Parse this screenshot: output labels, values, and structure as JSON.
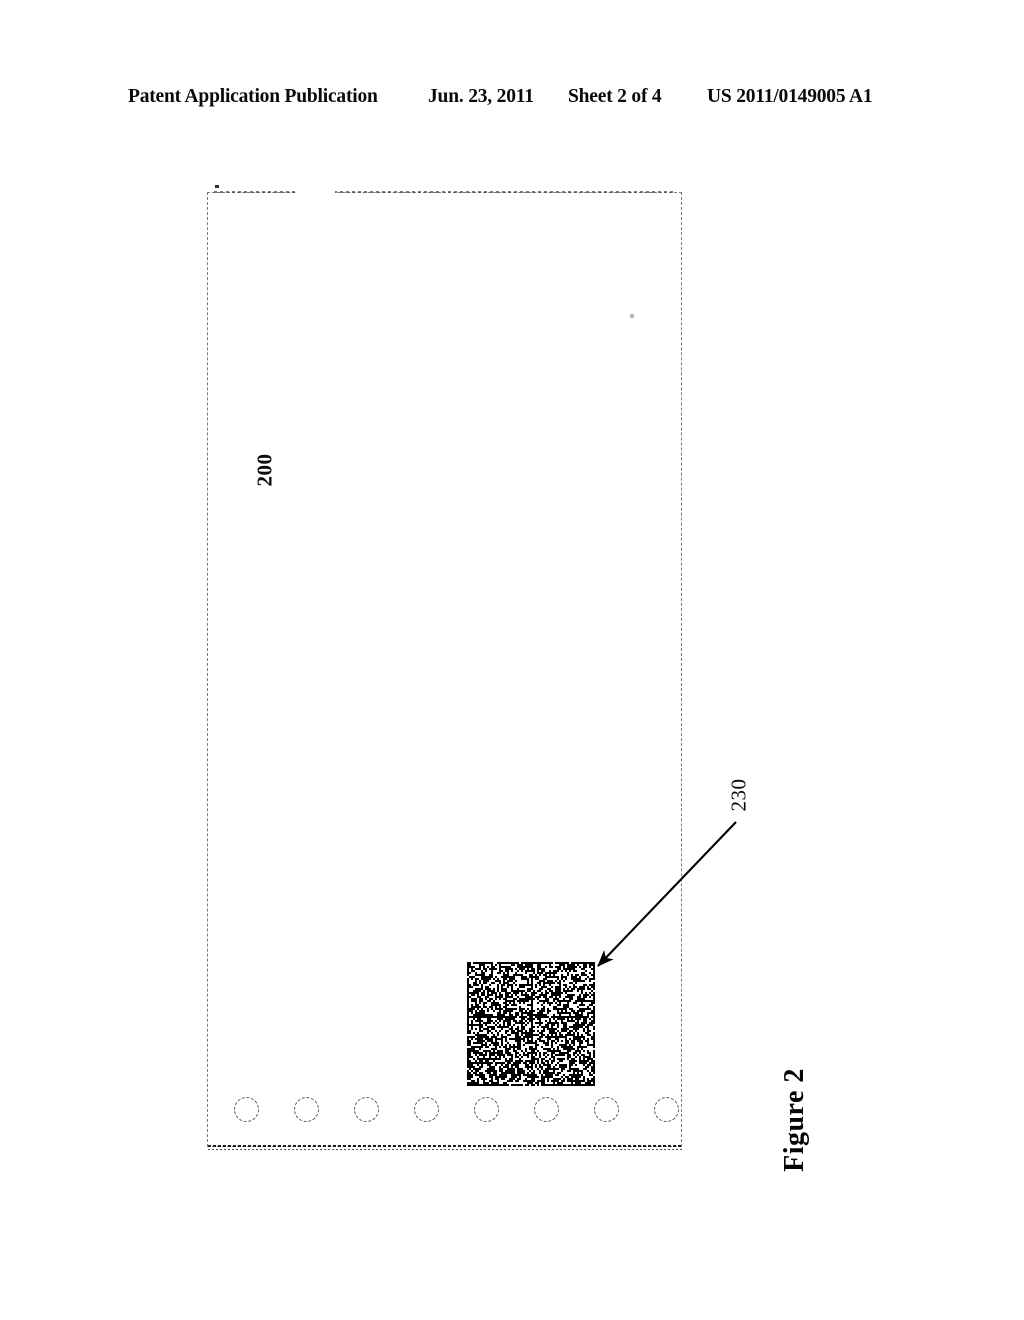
{
  "header": {
    "publication": "Patent Application Publication",
    "date": "Jun. 23, 2011",
    "sheet": "Sheet 2 of 4",
    "patent_number": "US 2011/0149005 A1"
  },
  "figure": {
    "caption": "Figure 2",
    "device_reference": "200",
    "code_reference": "230"
  },
  "drawing": {
    "device_outline_name": "device-body-outline",
    "code_block_name": "two-dimensional-code-block",
    "leader_line_name": "leader-line-230",
    "circle_count": 8,
    "circle_positions_x": [
      27,
      87,
      147,
      207,
      267,
      327,
      387,
      447
    ]
  },
  "colors": {
    "ink": "#000000",
    "outline": "#7a7a7a",
    "page_background": "#ffffff"
  }
}
